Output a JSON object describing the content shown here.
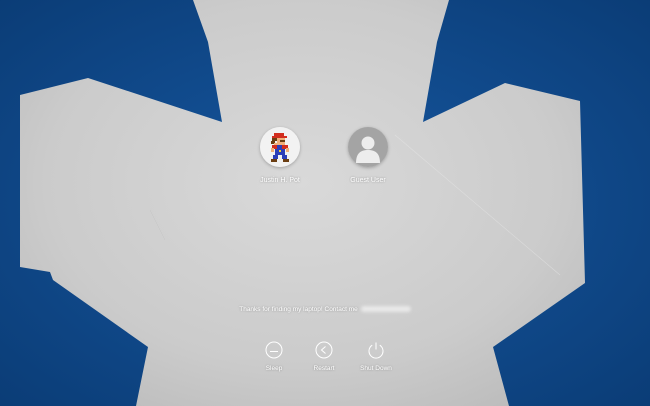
{
  "users": [
    {
      "name": "Justin H. Pot",
      "avatar_icon": "mario-avatar-icon"
    },
    {
      "name": "Guest User",
      "avatar_icon": "guest-user-icon"
    }
  ],
  "lock_message": {
    "text": "Thanks for finding my laptop! Contact me"
  },
  "power_buttons": {
    "sleep": {
      "label": "Sleep",
      "icon": "sleep-icon"
    },
    "restart": {
      "label": "Restart",
      "icon": "restart-icon"
    },
    "shutdown": {
      "label": "Shut Down",
      "icon": "power-icon"
    }
  },
  "colors": {
    "background_blue": "#0c4a8c",
    "leaf_gray": "#d3d3d3",
    "text": "#ffffff"
  }
}
